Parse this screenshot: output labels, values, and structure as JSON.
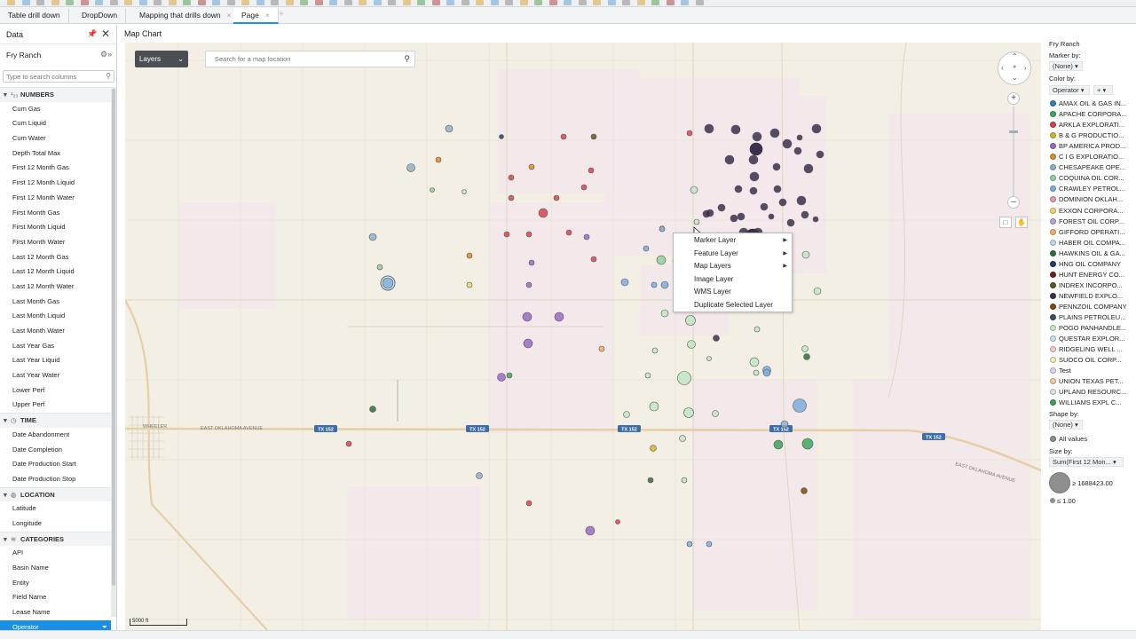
{
  "tabs": [
    {
      "label": "Table drill down",
      "closable": false,
      "active": false
    },
    {
      "label": "DropDown",
      "closable": false,
      "active": false
    },
    {
      "label": "Mapping that drills down",
      "closable": true,
      "active": false
    },
    {
      "label": "Page",
      "closable": true,
      "active": true
    }
  ],
  "tab_close_glyph": "×",
  "tab_add_glyph": "+",
  "data_panel": {
    "title": "Data",
    "source_name": "Fry Ranch",
    "search_placeholder": "Type to search columns",
    "groups": [
      {
        "name": "NUMBERS",
        "icon": "numbers-icon",
        "fields": [
          "Cum Gas",
          "Cum Liquid",
          "Cum Water",
          "Depth Total Max",
          "First 12 Month Gas",
          "First 12 Month Liquid",
          "First 12 Month Water",
          "First Month Gas",
          "First Month Liquid",
          "First Month Water",
          "Last 12 Month Gas",
          "Last 12 Month Liquid",
          "Last 12 Month Water",
          "Last Month Gas",
          "Last Month Liquid",
          "Last Month Water",
          "Last Year Gas",
          "Last Year Liquid",
          "Last Year Water",
          "Lower Perf",
          "Upper Perf"
        ]
      },
      {
        "name": "TIME",
        "icon": "clock-icon",
        "fields": [
          "Date Abandonment",
          "Date Completion",
          "Date Production Start",
          "Date Production Stop"
        ]
      },
      {
        "name": "LOCATION",
        "icon": "globe-icon",
        "fields": [
          "Latitude",
          "Longitude"
        ]
      },
      {
        "name": "CATEGORIES",
        "icon": "layers-icon",
        "fields": [
          "API",
          "Basin Name",
          "Entity",
          "Field Name",
          "Lease Name",
          "Operator"
        ]
      }
    ],
    "selected_field": "Operator"
  },
  "map": {
    "title": "Map Chart",
    "layers_button": "Layers",
    "search_placeholder": "Search for a map location",
    "scale_label": "5000 ft",
    "place_labels": [
      "WHEELER",
      "EAST OKLAHOMA AVENUE",
      "EAST OKLAHOMA AVENUE"
    ],
    "highway_shields": [
      "TX 152",
      "TX 152",
      "TX 152",
      "TX 152",
      "TX 152"
    ]
  },
  "context_menu": [
    {
      "label": "Marker Layer",
      "submenu": true
    },
    {
      "label": "Feature Layer",
      "submenu": true
    },
    {
      "label": "Map Layers",
      "submenu": true
    },
    {
      "label": "Image Layer",
      "submenu": false
    },
    {
      "label": "WMS Layer",
      "submenu": false
    },
    {
      "label": "Duplicate Selected Layer",
      "submenu": false
    }
  ],
  "legend": {
    "source_name": "Fry Ranch",
    "marker_by_label": "Marker by:",
    "marker_by_value": "(None)",
    "color_by_label": "Color by:",
    "color_by_value": "Operator",
    "operators": [
      {
        "name": "AMAX OIL & GAS IN...",
        "color": "#2f7fc1"
      },
      {
        "name": "APACHE CORPORA...",
        "color": "#3aaa5c"
      },
      {
        "name": "ARKLA EXPLORATI...",
        "color": "#d6454f"
      },
      {
        "name": "B & G PRODUCTIO...",
        "color": "#c8b82e"
      },
      {
        "name": "BP AMERICA PROD...",
        "color": "#9a6bc4"
      },
      {
        "name": "C I G EXPLORATIO...",
        "color": "#e08a2c"
      },
      {
        "name": "CHESAPEAKE OPE...",
        "color": "#8fb0c9"
      },
      {
        "name": "COQUINA OIL COR...",
        "color": "#8fd0a0"
      },
      {
        "name": "CRAWLEY PETROL...",
        "color": "#7aaee0"
      },
      {
        "name": "DOMINION OKLAH...",
        "color": "#e89aa8"
      },
      {
        "name": "EXXON CORPORA...",
        "color": "#f1d36a"
      },
      {
        "name": "FOREST OIL CORP...",
        "color": "#b8a4d8"
      },
      {
        "name": "GIFFORD OPERATI...",
        "color": "#f0b06a"
      },
      {
        "name": "HABER OIL COMPA...",
        "color": "#c2d8ea"
      },
      {
        "name": "HAWKINS OIL & GA...",
        "color": "#2e6e3c"
      },
      {
        "name": "HNG OIL COMPANY",
        "color": "#1e3f66"
      },
      {
        "name": "HUNT ENERGY CO...",
        "color": "#6e1e28"
      },
      {
        "name": "INDREX INCORPO...",
        "color": "#5b5a24"
      },
      {
        "name": "NEWFIELD EXPLO...",
        "color": "#3a2f4f"
      },
      {
        "name": "PENNZOIL COMPANY",
        "color": "#7a4a12"
      },
      {
        "name": "PLAINS PETROLEU...",
        "color": "#3d4f5c"
      },
      {
        "name": "POGO PANHANDLE...",
        "color": "#bfe8c4"
      },
      {
        "name": "QUESTAR EXPLOR...",
        "color": "#c9e0f2"
      },
      {
        "name": "RIDGELING WELL ...",
        "color": "#f6c7cc"
      },
      {
        "name": "SUOCO OIL CORP...",
        "color": "#f8eab4"
      },
      {
        "name": "Test",
        "color": "#ddd3ee"
      },
      {
        "name": "UNION TEXAS PET...",
        "color": "#f7c89a"
      },
      {
        "name": "UPLAND RESOURC...",
        "color": "#e2e2e2"
      },
      {
        "name": "WILLIAMS EXPL C...",
        "color": "#3aa05a"
      }
    ],
    "shape_by_label": "Shape by:",
    "shape_by_value": "(None)",
    "shape_all_values": "All values",
    "size_by_label": "Size by:",
    "size_by_value": "Sum(First 12 Mon...",
    "size_max_label": "≥ 1688423.00",
    "size_min_label": "≤ 1.00"
  }
}
